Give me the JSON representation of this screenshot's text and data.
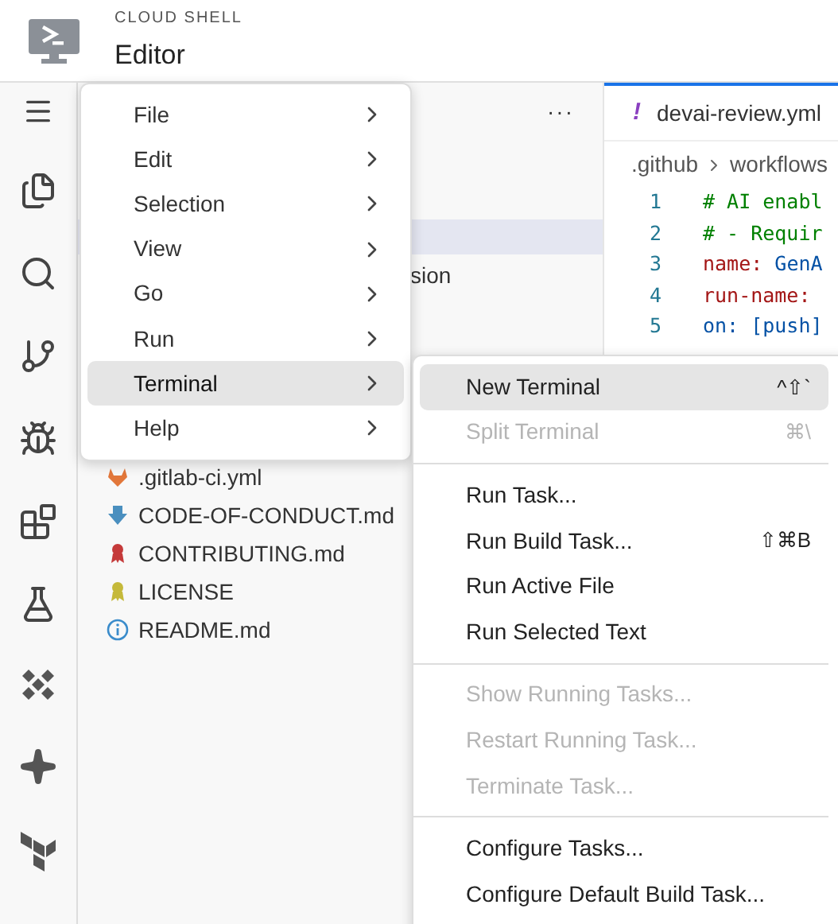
{
  "header": {
    "product": "CLOUD SHELL",
    "title": "Editor"
  },
  "explorer": {
    "more": "···",
    "partial_item": "sion",
    "files": [
      {
        "name": ".gitlab-ci.yml",
        "kind": "gitlab"
      },
      {
        "name": "CODE-OF-CONDUCT.md",
        "kind": "arrow"
      },
      {
        "name": "CONTRIBUTING.md",
        "kind": "ribbon"
      },
      {
        "name": "LICENSE",
        "kind": "license"
      },
      {
        "name": "README.md",
        "kind": "info"
      }
    ]
  },
  "editor": {
    "tab": {
      "icon": "!",
      "label": "devai-review.yml"
    },
    "breadcrumb": [
      ".github",
      "workflows"
    ],
    "lines": [
      {
        "number": "1",
        "tokens": [
          {
            "text": "# AI enabl",
            "kind": "comment"
          }
        ]
      },
      {
        "number": "2",
        "tokens": [
          {
            "text": "# - Requir",
            "kind": "comment"
          }
        ]
      },
      {
        "number": "3",
        "tokens": [
          {
            "text": "name:",
            "kind": "key"
          },
          {
            "text": " GenA",
            "kind": "value"
          }
        ]
      },
      {
        "number": "4",
        "tokens": [
          {
            "text": "run-name:",
            "kind": "key"
          }
        ]
      },
      {
        "number": "5",
        "tokens": [
          {
            "text": "on: [push]",
            "kind": "value"
          }
        ]
      }
    ]
  },
  "menu": [
    {
      "label": "File",
      "selected": false
    },
    {
      "label": "Edit",
      "selected": false
    },
    {
      "label": "Selection",
      "selected": false
    },
    {
      "label": "View",
      "selected": false
    },
    {
      "label": "Go",
      "selected": false
    },
    {
      "label": "Run",
      "selected": false
    },
    {
      "label": "Terminal",
      "selected": true
    },
    {
      "label": "Help",
      "selected": false
    }
  ],
  "submenu": [
    [
      {
        "label": "New Terminal",
        "shortcut": "^⇧`",
        "disabled": false,
        "selected": true
      },
      {
        "label": "Split Terminal",
        "shortcut": "⌘\\",
        "disabled": true,
        "selected": false
      }
    ],
    [
      {
        "label": "Run Task...",
        "disabled": false,
        "selected": false
      },
      {
        "label": "Run Build Task...",
        "shortcut": "⇧⌘B",
        "disabled": false,
        "selected": false
      },
      {
        "label": "Run Active File",
        "disabled": false,
        "selected": false
      },
      {
        "label": "Run Selected Text",
        "disabled": false,
        "selected": false
      }
    ],
    [
      {
        "label": "Show Running Tasks...",
        "disabled": true,
        "selected": false
      },
      {
        "label": "Restart Running Task...",
        "disabled": true,
        "selected": false
      },
      {
        "label": "Terminate Task...",
        "disabled": true,
        "selected": false
      }
    ],
    [
      {
        "label": "Configure Tasks...",
        "disabled": false,
        "selected": false
      },
      {
        "label": "Configure Default Build Task...",
        "disabled": false,
        "selected": false
      }
    ]
  ]
}
